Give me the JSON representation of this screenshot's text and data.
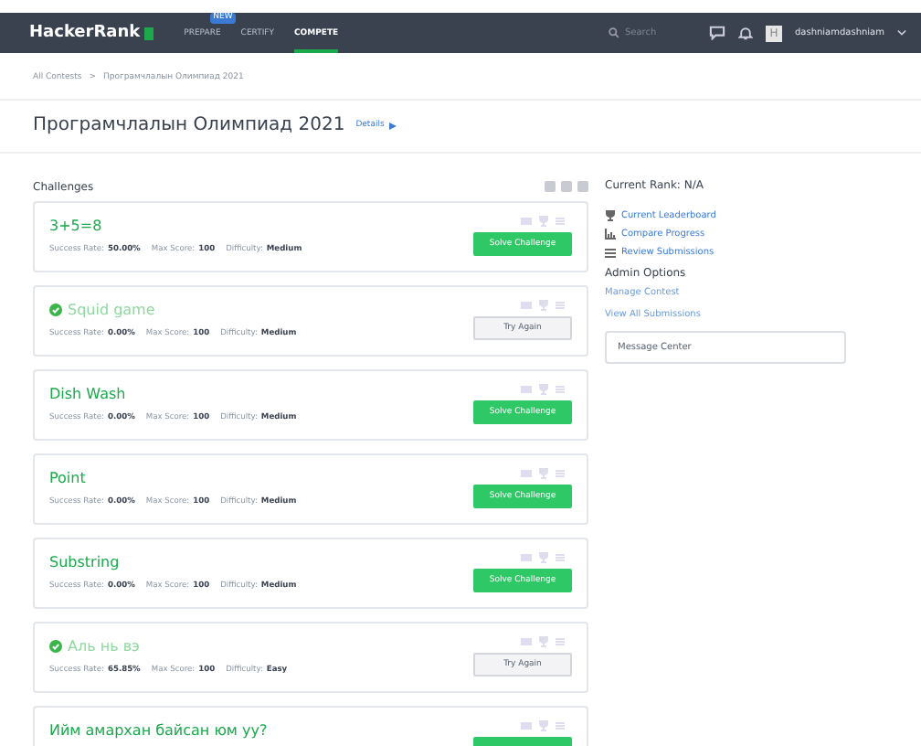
{
  "navbar": {
    "logo": "HackerRank",
    "tabs": [
      {
        "label": "PREPARE",
        "badge": "NEW",
        "selected": false
      },
      {
        "label": "CERTIFY",
        "selected": false
      },
      {
        "label": "COMPETE",
        "selected": true
      }
    ],
    "search": {
      "placeholder": "Search"
    },
    "avatar": "H",
    "username": "dashniamdashniam"
  },
  "breadcrumb": [
    "All Contests",
    ">",
    "Програмчлалын Олимпиад 2021"
  ],
  "title": "Програмчлалын Олимпиад 2021",
  "details_link": "Details",
  "challenges": {
    "heading": "Challenges",
    "items": [
      {
        "name": "3+5=8",
        "solved": false,
        "success_label": "Success Rate:",
        "success_rate": "50.00%",
        "score_label": "Max Score:",
        "max_score": "100",
        "difficulty_label": "Difficulty:",
        "difficulty": "Medium",
        "button": "Solve Challenge"
      },
      {
        "name": "Squid game",
        "solved": true,
        "success_label": "Success Rate:",
        "success_rate": "0.00%",
        "score_label": "Max Score:",
        "max_score": "100",
        "difficulty_label": "Difficulty:",
        "difficulty": "Medium",
        "button": "Try Again"
      },
      {
        "name": "Dish Wash",
        "solved": false,
        "success_label": "Success Rate:",
        "success_rate": "0.00%",
        "score_label": "Max Score:",
        "max_score": "100",
        "difficulty_label": "Difficulty:",
        "difficulty": "Medium",
        "button": "Solve Challenge"
      },
      {
        "name": "Point",
        "solved": false,
        "success_label": "Success Rate:",
        "success_rate": "0.00%",
        "score_label": "Max Score:",
        "max_score": "100",
        "difficulty_label": "Difficulty:",
        "difficulty": "Medium",
        "button": "Solve Challenge"
      },
      {
        "name": "Substring",
        "solved": false,
        "success_label": "Success Rate:",
        "success_rate": "0.00%",
        "score_label": "Max Score:",
        "max_score": "100",
        "difficulty_label": "Difficulty:",
        "difficulty": "Medium",
        "button": "Solve Challenge"
      },
      {
        "name": "Аль нь вэ",
        "solved": true,
        "success_label": "Success Rate:",
        "success_rate": "65.85%",
        "score_label": "Max Score:",
        "max_score": "100",
        "difficulty_label": "Difficulty:",
        "difficulty": "Easy",
        "button": "Try Again"
      },
      {
        "name": "Ийм амархан байсан юм уу?",
        "solved": false
      }
    ]
  },
  "sidebar": {
    "rank": "Current Rank: N/A",
    "links": [
      {
        "kind": "trophy",
        "label": "Current Leaderboard"
      },
      {
        "kind": "chart",
        "label": "Compare Progress"
      },
      {
        "kind": "list",
        "label": "Review Submissions"
      }
    ],
    "admin_heading": "Admin Options",
    "admin_links": [
      "Manage Contest",
      "View All Submissions"
    ],
    "message_center": "Message Center"
  }
}
